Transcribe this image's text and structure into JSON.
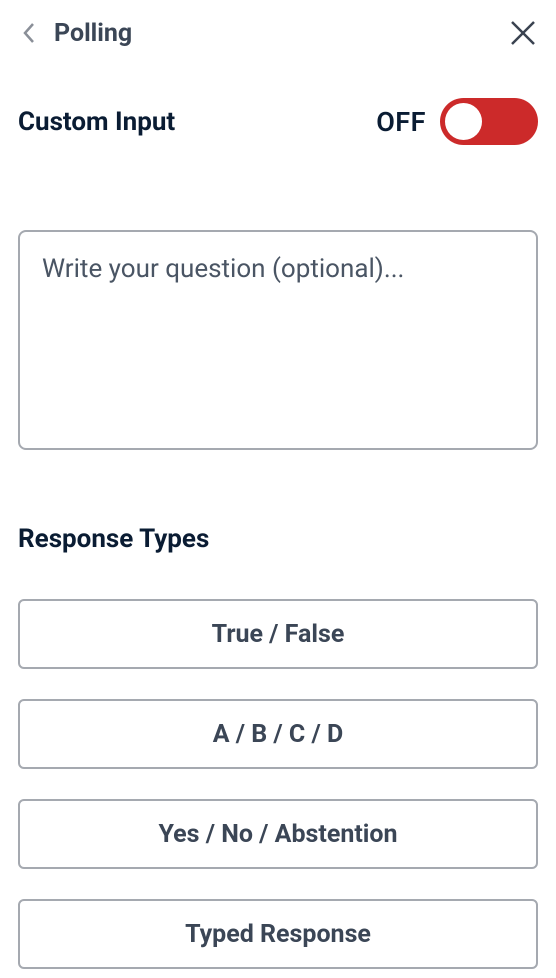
{
  "header": {
    "title": "Polling"
  },
  "toggle": {
    "label": "Custom Input",
    "state": "OFF"
  },
  "question": {
    "placeholder": "Write your question (optional)...",
    "value": ""
  },
  "responses": {
    "section_title": "Response Types",
    "options": [
      "True / False",
      "A / B / C / D",
      "Yes / No / Abstention",
      "Typed Response"
    ]
  }
}
